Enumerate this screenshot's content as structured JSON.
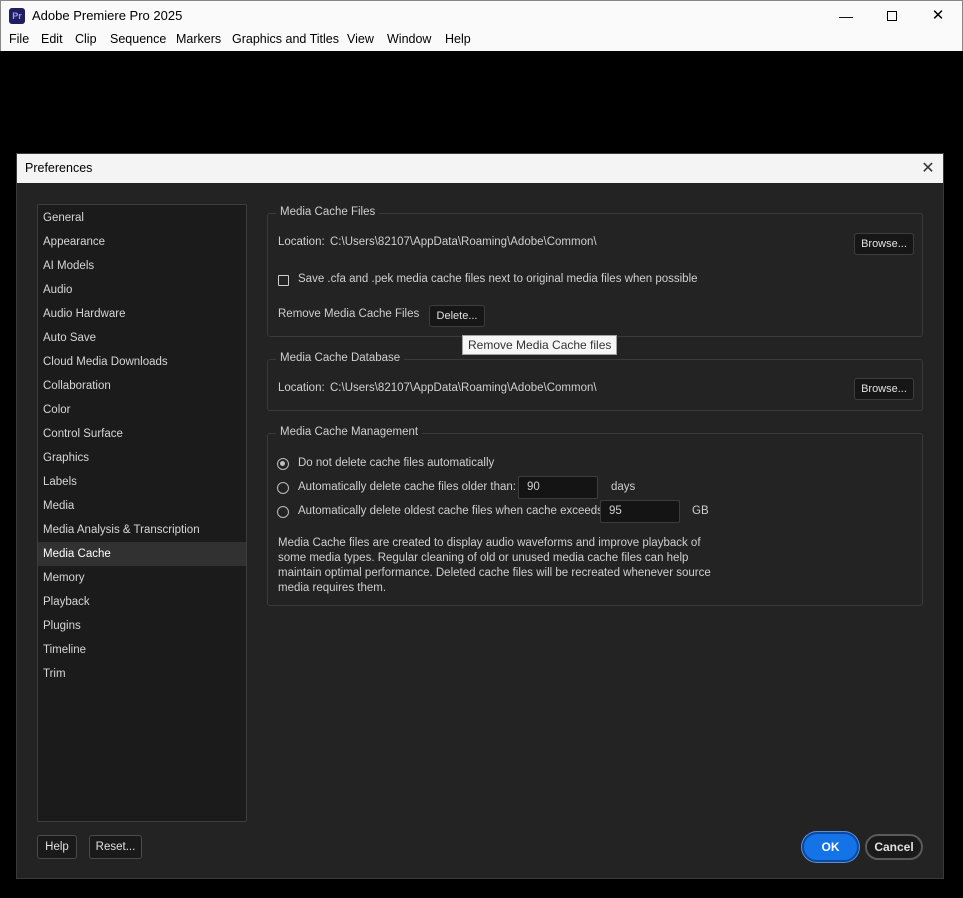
{
  "app": {
    "title": "Adobe Premiere Pro 2025",
    "logo": "Pr",
    "minimize": "—",
    "close": "✕"
  },
  "menu": [
    "File",
    "Edit",
    "Clip",
    "Sequence",
    "Markers",
    "Graphics and Titles",
    "View",
    "Window",
    "Help"
  ],
  "dialog": {
    "title": "Preferences",
    "close": "✕",
    "sidebar": [
      "General",
      "Appearance",
      "AI Models",
      "Audio",
      "Audio Hardware",
      "Auto Save",
      "Cloud Media Downloads",
      "Collaboration",
      "Color",
      "Control Surface",
      "Graphics",
      "Labels",
      "Media",
      "Media Analysis & Transcription",
      "Media Cache",
      "Memory",
      "Playback",
      "Plugins",
      "Timeline",
      "Trim"
    ],
    "selected_sidebar": "Media Cache",
    "cache_files": {
      "title": "Media Cache Files",
      "location_label": "Location:",
      "location_path": "C:\\Users\\82107\\AppData\\Roaming\\Adobe\\Common\\",
      "browse": "Browse...",
      "checkbox_label": "Save .cfa and .pek media cache files next to original media files when possible",
      "checkbox_checked": false,
      "remove_label": "Remove Media Cache Files",
      "delete": "Delete..."
    },
    "tooltip": "Remove Media Cache files",
    "cache_db": {
      "title": "Media Cache Database",
      "location_label": "Location:",
      "location_path": "C:\\Users\\82107\\AppData\\Roaming\\Adobe\\Common\\",
      "browse": "Browse..."
    },
    "management": {
      "title": "Media Cache Management",
      "option_none": "Do not delete cache files automatically",
      "option_older": "Automatically delete cache files older than:",
      "older_value": "90",
      "older_unit": "days",
      "option_exceeds": "Automatically delete oldest cache files when cache exceeds:",
      "exceeds_value": "95",
      "exceeds_unit": "GB",
      "selected": "none",
      "description": "Media Cache files are created to display audio waveforms and improve playback of some media types.  Regular cleaning of old or unused media cache files can help maintain optimal performance. Deleted cache files will be recreated whenever source media requires them."
    },
    "footer": {
      "help": "Help",
      "reset": "Reset...",
      "ok": "OK",
      "cancel": "Cancel"
    }
  }
}
